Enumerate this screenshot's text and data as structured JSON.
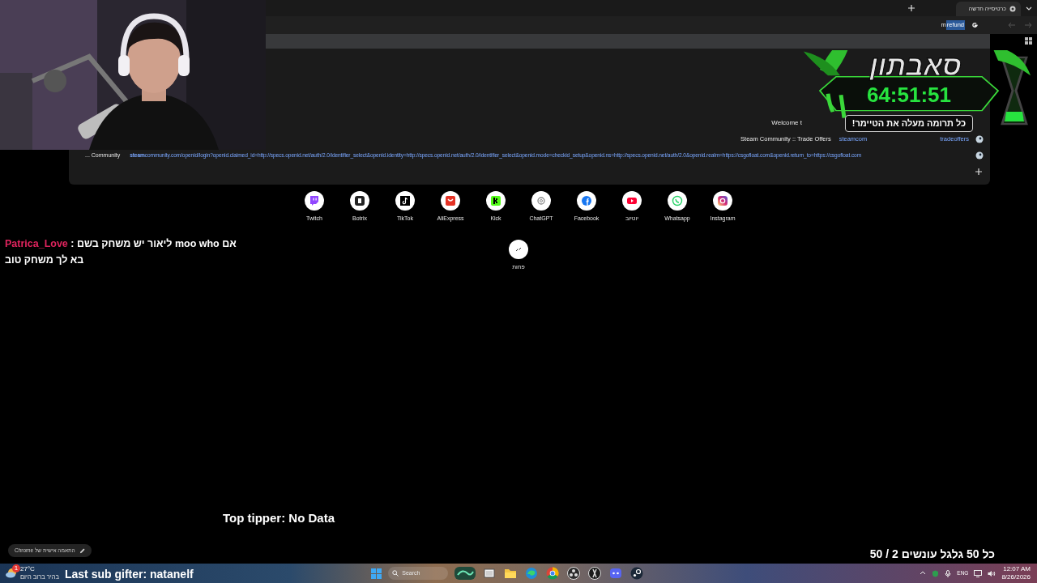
{
  "browser": {
    "tab": {
      "title": "כרטיסייה חדשה",
      "selected": true
    },
    "omnibox": {
      "typed": "m",
      "completion": "refund"
    },
    "suggestions": [
      {
        "kind": "text",
        "text": "Welcome t"
      },
      {
        "kind": "split",
        "title": "Steam Community :: Trade Offers",
        "url_start": "steamcom",
        "url_end": "tradeoffers"
      },
      {
        "kind": "link",
        "title": "... Community",
        "url": "**steam**community.com/openid/login?openid.claimed_id=http://specs.openid.net/auth/2.0/identifier_select&openid.identity=http://specs.openid.net/auth/2.0/identifier_select&openid.mode=checkid_setup&openid.ns=http://specs.openid.net/auth/2.0&openid.realm=https://csgofloat.com&openid.return_to=https://csgofloat.com"
      }
    ],
    "shortcuts": [
      {
        "label": "Instagram",
        "kind": "instagram"
      },
      {
        "label": "Whatsapp",
        "kind": "whatsapp"
      },
      {
        "label": "יוטיוב",
        "kind": "youtube"
      },
      {
        "label": "Facebook",
        "kind": "facebook"
      },
      {
        "label": "ChatGPT",
        "kind": "chatgpt"
      },
      {
        "label": "Kick",
        "kind": "kick"
      },
      {
        "label": "AliExpress",
        "kind": "aliexpress"
      },
      {
        "label": "TikTok",
        "kind": "tiktok"
      },
      {
        "label": "Botrix",
        "kind": "botrix"
      },
      {
        "label": "Twitch",
        "kind": "twitch"
      }
    ],
    "more": {
      "label": "פחות"
    },
    "customize": "התאמה אישית של Chrome"
  },
  "overlay": {
    "title": "סאבתון",
    "timer": "64:51:51",
    "subtitle": "כל תרומה **מעלה** את הטיימר!"
  },
  "chat": [
    {
      "user": "Patrica_Love",
      "color": "#e0245e",
      "separator": ":",
      "text": "ליאור יש משחק בשם moo who אם בא לך משחק טוב"
    }
  ],
  "top_tipper": "Top tipper: No Data",
  "wheel_goal": "כל 50 גלגל עונשים 2 / 50",
  "last_sub_gifter": "Last sub gifter: natanelf",
  "taskbar": {
    "weather": {
      "badge": "1",
      "temp": "27°C",
      "desc": "בהיר ברוב היום"
    },
    "search": "Search",
    "apps": [
      {
        "kind": "widgets"
      },
      {
        "kind": "taskview"
      },
      {
        "kind": "folder"
      },
      {
        "kind": "edge"
      },
      {
        "kind": "chrome"
      },
      {
        "kind": "obs"
      },
      {
        "kind": "app"
      },
      {
        "kind": "discord"
      },
      {
        "kind": "steam"
      }
    ],
    "language": "ENG",
    "time": "12:07 AM",
    "date": "8/26/2026"
  }
}
